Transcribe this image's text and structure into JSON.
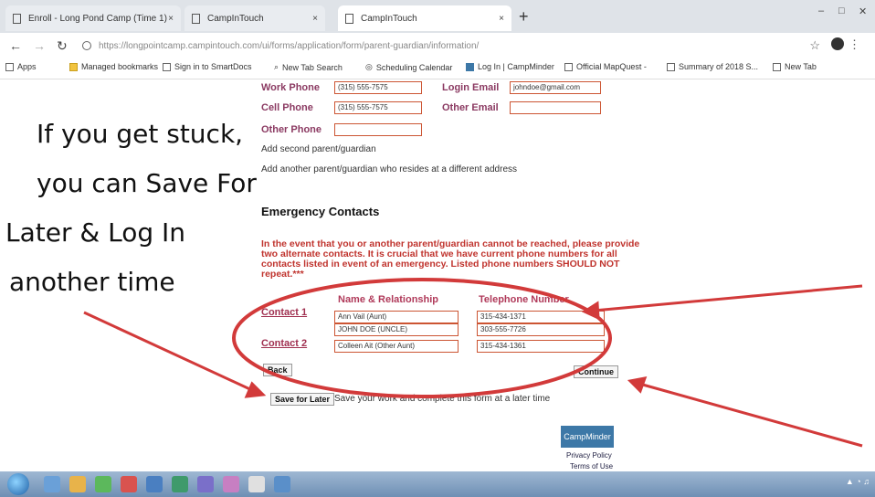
{
  "browser": {
    "tabs": [
      {
        "label": "Enroll - Long Pond Camp (Time 1)"
      },
      {
        "label": "CampInTouch"
      },
      {
        "label": "CampInTouch"
      }
    ],
    "url": "https://longpointcamp.campintouch.com/ui/forms/application/form/parent-guardian/information/",
    "bookmarks": [
      "Apps",
      "Managed bookmarks",
      "Sign in to SmartDocs",
      "New Tab Search",
      "Scheduling Calendar",
      "Log In | CampMinder",
      "Official MapQuest -",
      "Summary of 2018 S...",
      "New Tab"
    ]
  },
  "form": {
    "work_phone_label": "Work Phone",
    "work_phone_value": "(315) 555-7575",
    "cell_phone_label": "Cell Phone",
    "cell_phone_value": "(315) 555-7575",
    "other_phone_label": "Other Phone",
    "other_phone_value": "",
    "login_email_label": "Login Email",
    "login_email_value": "johndoe@gmail.com",
    "other_email_label": "Other Email",
    "other_email_value": "",
    "add_second_parent": "Add second parent/guardian",
    "add_another_parent": "Add another parent/guardian who resides at a different address"
  },
  "emergency": {
    "heading": "Emergency Contacts",
    "notice": "In the event that you or another parent/guardian cannot be reached, please provide two alternate contacts. It is crucial that we have current phone numbers for all contacts listed in event of an emergency. Listed phone numbers SHOULD NOT repeat.***",
    "col_name": "Name & Relationship",
    "col_phone": "Telephone Number",
    "contacts": [
      {
        "label": "Contact 1",
        "name": "Ann Vail (Aunt)",
        "relation_line": "JOHN DOE (UNCLE)",
        "phone": "315-434-1371",
        "phone2": "303-555-7726"
      },
      {
        "label": "Contact 2",
        "name": "Colleen Ait (Other Aunt)",
        "phone": "315-434-1361"
      }
    ]
  },
  "buttons": {
    "back": "Back",
    "continue": "Continue",
    "save_later": "Save for Later",
    "save_later_desc": "Save your work and complete this form at a later time"
  },
  "footer": {
    "logo": "CampMinder",
    "privacy": "Privacy Policy",
    "terms": "Terms of Use"
  },
  "annotation": {
    "lines": [
      "If you get stuck,",
      "you can Save For",
      "Later & Log In",
      "another time"
    ],
    "color": "#d23a3a"
  }
}
